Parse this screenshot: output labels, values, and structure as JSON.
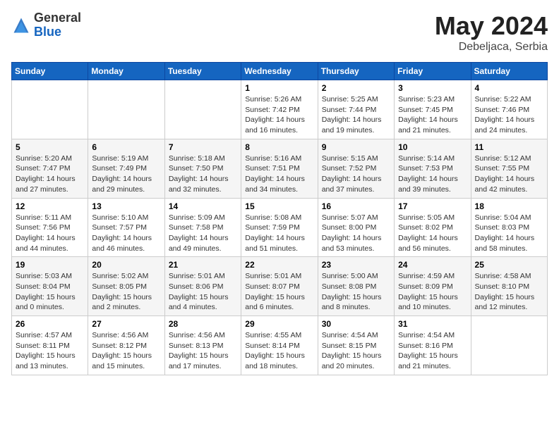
{
  "logo": {
    "general": "General",
    "blue": "Blue"
  },
  "title": {
    "month_year": "May 2024",
    "location": "Debeljaca, Serbia"
  },
  "weekdays": [
    "Sunday",
    "Monday",
    "Tuesday",
    "Wednesday",
    "Thursday",
    "Friday",
    "Saturday"
  ],
  "weeks": [
    [
      {
        "day": "",
        "sunrise": "",
        "sunset": "",
        "daylight": ""
      },
      {
        "day": "",
        "sunrise": "",
        "sunset": "",
        "daylight": ""
      },
      {
        "day": "",
        "sunrise": "",
        "sunset": "",
        "daylight": ""
      },
      {
        "day": "1",
        "sunrise": "Sunrise: 5:26 AM",
        "sunset": "Sunset: 7:42 PM",
        "daylight": "Daylight: 14 hours and 16 minutes."
      },
      {
        "day": "2",
        "sunrise": "Sunrise: 5:25 AM",
        "sunset": "Sunset: 7:44 PM",
        "daylight": "Daylight: 14 hours and 19 minutes."
      },
      {
        "day": "3",
        "sunrise": "Sunrise: 5:23 AM",
        "sunset": "Sunset: 7:45 PM",
        "daylight": "Daylight: 14 hours and 21 minutes."
      },
      {
        "day": "4",
        "sunrise": "Sunrise: 5:22 AM",
        "sunset": "Sunset: 7:46 PM",
        "daylight": "Daylight: 14 hours and 24 minutes."
      }
    ],
    [
      {
        "day": "5",
        "sunrise": "Sunrise: 5:20 AM",
        "sunset": "Sunset: 7:47 PM",
        "daylight": "Daylight: 14 hours and 27 minutes."
      },
      {
        "day": "6",
        "sunrise": "Sunrise: 5:19 AM",
        "sunset": "Sunset: 7:49 PM",
        "daylight": "Daylight: 14 hours and 29 minutes."
      },
      {
        "day": "7",
        "sunrise": "Sunrise: 5:18 AM",
        "sunset": "Sunset: 7:50 PM",
        "daylight": "Daylight: 14 hours and 32 minutes."
      },
      {
        "day": "8",
        "sunrise": "Sunrise: 5:16 AM",
        "sunset": "Sunset: 7:51 PM",
        "daylight": "Daylight: 14 hours and 34 minutes."
      },
      {
        "day": "9",
        "sunrise": "Sunrise: 5:15 AM",
        "sunset": "Sunset: 7:52 PM",
        "daylight": "Daylight: 14 hours and 37 minutes."
      },
      {
        "day": "10",
        "sunrise": "Sunrise: 5:14 AM",
        "sunset": "Sunset: 7:53 PM",
        "daylight": "Daylight: 14 hours and 39 minutes."
      },
      {
        "day": "11",
        "sunrise": "Sunrise: 5:12 AM",
        "sunset": "Sunset: 7:55 PM",
        "daylight": "Daylight: 14 hours and 42 minutes."
      }
    ],
    [
      {
        "day": "12",
        "sunrise": "Sunrise: 5:11 AM",
        "sunset": "Sunset: 7:56 PM",
        "daylight": "Daylight: 14 hours and 44 minutes."
      },
      {
        "day": "13",
        "sunrise": "Sunrise: 5:10 AM",
        "sunset": "Sunset: 7:57 PM",
        "daylight": "Daylight: 14 hours and 46 minutes."
      },
      {
        "day": "14",
        "sunrise": "Sunrise: 5:09 AM",
        "sunset": "Sunset: 7:58 PM",
        "daylight": "Daylight: 14 hours and 49 minutes."
      },
      {
        "day": "15",
        "sunrise": "Sunrise: 5:08 AM",
        "sunset": "Sunset: 7:59 PM",
        "daylight": "Daylight: 14 hours and 51 minutes."
      },
      {
        "day": "16",
        "sunrise": "Sunrise: 5:07 AM",
        "sunset": "Sunset: 8:00 PM",
        "daylight": "Daylight: 14 hours and 53 minutes."
      },
      {
        "day": "17",
        "sunrise": "Sunrise: 5:05 AM",
        "sunset": "Sunset: 8:02 PM",
        "daylight": "Daylight: 14 hours and 56 minutes."
      },
      {
        "day": "18",
        "sunrise": "Sunrise: 5:04 AM",
        "sunset": "Sunset: 8:03 PM",
        "daylight": "Daylight: 14 hours and 58 minutes."
      }
    ],
    [
      {
        "day": "19",
        "sunrise": "Sunrise: 5:03 AM",
        "sunset": "Sunset: 8:04 PM",
        "daylight": "Daylight: 15 hours and 0 minutes."
      },
      {
        "day": "20",
        "sunrise": "Sunrise: 5:02 AM",
        "sunset": "Sunset: 8:05 PM",
        "daylight": "Daylight: 15 hours and 2 minutes."
      },
      {
        "day": "21",
        "sunrise": "Sunrise: 5:01 AM",
        "sunset": "Sunset: 8:06 PM",
        "daylight": "Daylight: 15 hours and 4 minutes."
      },
      {
        "day": "22",
        "sunrise": "Sunrise: 5:01 AM",
        "sunset": "Sunset: 8:07 PM",
        "daylight": "Daylight: 15 hours and 6 minutes."
      },
      {
        "day": "23",
        "sunrise": "Sunrise: 5:00 AM",
        "sunset": "Sunset: 8:08 PM",
        "daylight": "Daylight: 15 hours and 8 minutes."
      },
      {
        "day": "24",
        "sunrise": "Sunrise: 4:59 AM",
        "sunset": "Sunset: 8:09 PM",
        "daylight": "Daylight: 15 hours and 10 minutes."
      },
      {
        "day": "25",
        "sunrise": "Sunrise: 4:58 AM",
        "sunset": "Sunset: 8:10 PM",
        "daylight": "Daylight: 15 hours and 12 minutes."
      }
    ],
    [
      {
        "day": "26",
        "sunrise": "Sunrise: 4:57 AM",
        "sunset": "Sunset: 8:11 PM",
        "daylight": "Daylight: 15 hours and 13 minutes."
      },
      {
        "day": "27",
        "sunrise": "Sunrise: 4:56 AM",
        "sunset": "Sunset: 8:12 PM",
        "daylight": "Daylight: 15 hours and 15 minutes."
      },
      {
        "day": "28",
        "sunrise": "Sunrise: 4:56 AM",
        "sunset": "Sunset: 8:13 PM",
        "daylight": "Daylight: 15 hours and 17 minutes."
      },
      {
        "day": "29",
        "sunrise": "Sunrise: 4:55 AM",
        "sunset": "Sunset: 8:14 PM",
        "daylight": "Daylight: 15 hours and 18 minutes."
      },
      {
        "day": "30",
        "sunrise": "Sunrise: 4:54 AM",
        "sunset": "Sunset: 8:15 PM",
        "daylight": "Daylight: 15 hours and 20 minutes."
      },
      {
        "day": "31",
        "sunrise": "Sunrise: 4:54 AM",
        "sunset": "Sunset: 8:16 PM",
        "daylight": "Daylight: 15 hours and 21 minutes."
      },
      {
        "day": "",
        "sunrise": "",
        "sunset": "",
        "daylight": ""
      }
    ]
  ]
}
